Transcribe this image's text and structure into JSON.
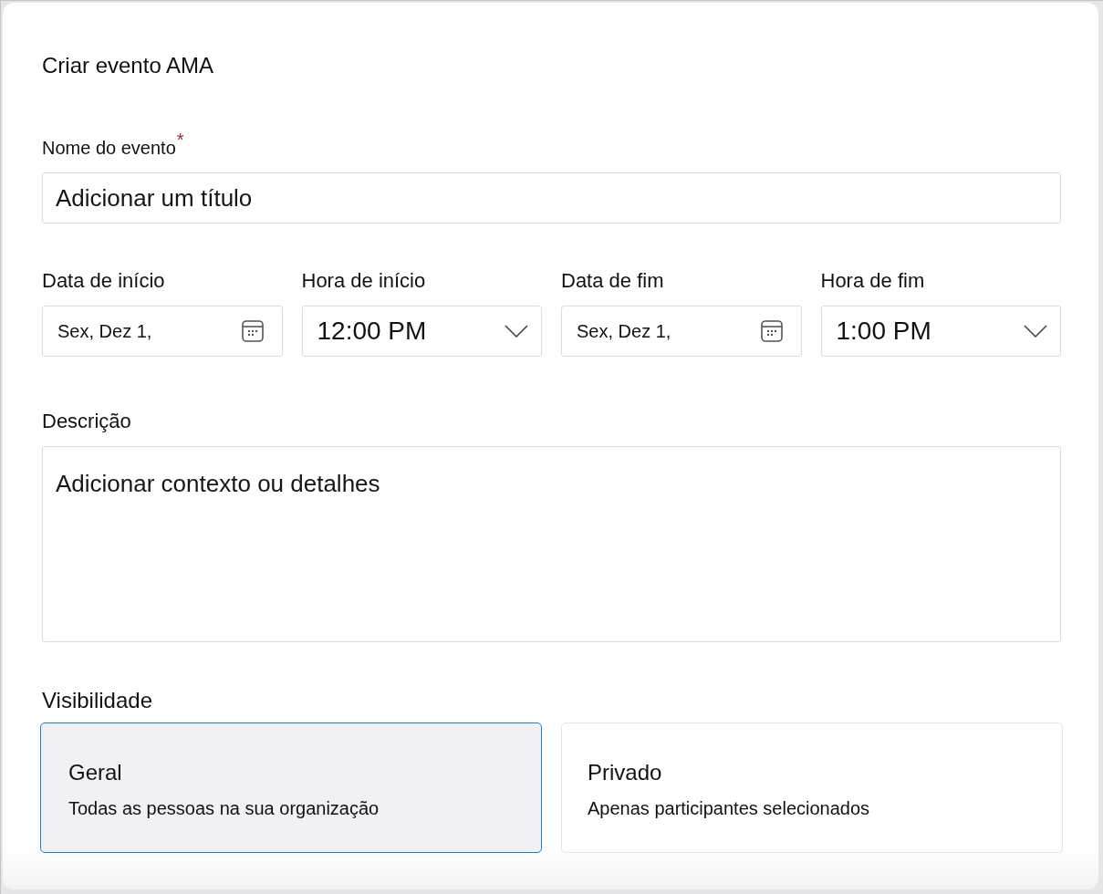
{
  "dialog": {
    "title": "Criar evento AMA"
  },
  "event_name": {
    "label": "Nome do evento",
    "required_mark": "*",
    "placeholder": "Adicionar um título"
  },
  "schedule": [
    {
      "kind": "date",
      "label": "Data de início",
      "value": "Sex, Dez 1,"
    },
    {
      "kind": "time",
      "label": "Hora de início",
      "value": "12:00 PM"
    },
    {
      "kind": "date",
      "label": "Data de fim",
      "value": "Sex, Dez 1,"
    },
    {
      "kind": "time",
      "label": "Hora de fim",
      "value": "1:00 PM"
    }
  ],
  "description": {
    "label": "Descrição",
    "placeholder": "Adicionar contexto ou detalhes"
  },
  "visibility": {
    "label": "Visibilidade",
    "options": [
      {
        "title": "Geral",
        "description": "Todas as pessoas na sua organização",
        "selected": true
      },
      {
        "title": "Privado",
        "description": "Apenas participantes selecionados",
        "selected": false
      }
    ]
  }
}
